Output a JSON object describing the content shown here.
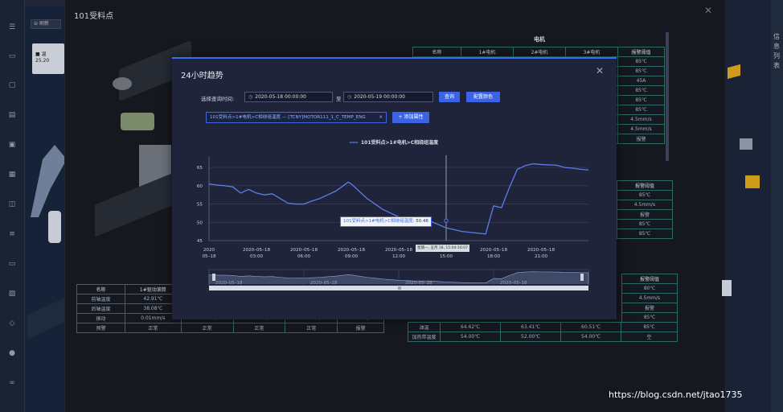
{
  "window": {
    "background_title": "101受料点"
  },
  "modal": {
    "title": "24小时趋势",
    "time_label": "选择查询时间:",
    "start_time": "2020-05-18 00:00:00",
    "separator": "至",
    "end_time": "2020-05-19 00:00:00",
    "query_button": "查询",
    "color_button": "配置颜色",
    "tag_text": "101受料点>1#电机>C相绕组温度 — [TCNY]MOTOR111_1_C_TEMP_ENG",
    "add_attr_button": "+ 添加属性"
  },
  "tooltip": {
    "series": "101受料点>1#电机>C相绕组温度:",
    "value": "50.46"
  },
  "axis_pointer_label": "星期一, 五月 18, 15:04-16:07",
  "chart_data": {
    "type": "line",
    "series": [
      {
        "name": "101受料点>1#电机>C相绕组温度",
        "color": "#5b7de8",
        "points": [
          [
            0.0,
            60.5
          ],
          [
            0.5,
            60.2
          ],
          [
            1.0,
            60.0
          ],
          [
            1.5,
            59.7
          ],
          [
            2.0,
            58.0
          ],
          [
            2.5,
            59.0
          ],
          [
            3.0,
            58.0
          ],
          [
            3.5,
            57.5
          ],
          [
            4.0,
            57.8
          ],
          [
            4.5,
            56.5
          ],
          [
            5.0,
            55.2
          ],
          [
            5.5,
            55.0
          ],
          [
            6.0,
            55.0
          ],
          [
            6.5,
            55.8
          ],
          [
            7.0,
            56.5
          ],
          [
            7.5,
            57.5
          ],
          [
            8.0,
            58.5
          ],
          [
            8.5,
            60.0
          ],
          [
            8.8,
            61.0
          ],
          [
            9.0,
            60.5
          ],
          [
            9.5,
            58.5
          ],
          [
            10.0,
            56.5
          ],
          [
            10.5,
            55.0
          ],
          [
            11.0,
            53.5
          ],
          [
            11.5,
            52.5
          ],
          [
            12.0,
            51.5
          ],
          [
            12.5,
            51.0
          ],
          [
            13.0,
            50.2
          ],
          [
            14.0,
            50.3
          ],
          [
            15.0,
            48.5
          ],
          [
            16.0,
            47.5
          ],
          [
            17.5,
            46.8
          ],
          [
            18.0,
            54.5
          ],
          [
            18.5,
            54.0
          ],
          [
            19.0,
            59.5
          ],
          [
            19.5,
            64.5
          ],
          [
            20.0,
            65.5
          ],
          [
            20.5,
            66.0
          ],
          [
            21.0,
            65.8
          ],
          [
            21.5,
            65.7
          ],
          [
            22.0,
            65.6
          ],
          [
            22.5,
            65.0
          ],
          [
            23.0,
            64.8
          ],
          [
            23.5,
            64.5
          ],
          [
            24.0,
            64.3
          ]
        ]
      }
    ],
    "x_axis": {
      "min_hours": 0,
      "max_hours": 24,
      "ticks": [
        {
          "hours": 0,
          "label": "2020\n05–18"
        },
        {
          "hours": 3,
          "label": "2020–05–18\n03:00"
        },
        {
          "hours": 6,
          "label": "2020–05–18\n06:00"
        },
        {
          "hours": 9,
          "label": "2020–05–18\n09:00"
        },
        {
          "hours": 12,
          "label": "2020–05–18\n12:00"
        },
        {
          "hours": 15,
          "label": "2020–05–18\n15:00"
        },
        {
          "hours": 18,
          "label": "2020–05–18\n18:00"
        },
        {
          "hours": 21,
          "label": "2020–05–18\n21:00"
        }
      ]
    },
    "y_axis": {
      "min": 45,
      "max": 67,
      "ticks": [
        45,
        50,
        55,
        60,
        65
      ]
    },
    "crosshair_hours": 15.0,
    "highlight_point": [
      15.0,
      50.46
    ],
    "slider_labels": [
      "2020–05–18",
      "2020–05–18",
      "2020–05–18",
      "2020–05–18"
    ]
  },
  "bg_right_table": {
    "title": "电机",
    "headers": [
      "名称",
      "1#电机",
      "2#电机",
      "3#电机",
      "报警阈值"
    ],
    "thresholds": [
      "85℃",
      "85℃",
      "45A",
      "85℃",
      "85℃",
      "85℃",
      "4.5mm/s",
      "4.5mm/s",
      "报警"
    ]
  },
  "bg_right_table2": {
    "header": "报警阈值",
    "values": [
      "85℃",
      "4.5mm/s",
      "报警",
      "85℃",
      "85℃"
    ]
  },
  "bg_right_table3": {
    "header": "报警阈值",
    "values": [
      "80℃",
      "4.5mm/s",
      "报警",
      "85℃"
    ],
    "rows": [
      [
        "油温",
        "64.62℃",
        "63.41℃",
        "60.51℃",
        "85℃"
      ],
      [
        "加热带温度",
        "54.00℃",
        "52.00℃",
        "54.00℃",
        "空"
      ]
    ]
  },
  "bg_left_table": {
    "headers": [
      "名称",
      "1#驱动滚筒"
    ],
    "rows": [
      [
        "前轴温度",
        "42.91℃",
        "",
        "",
        "",
        ""
      ],
      [
        "后轴温度",
        "38.08℃",
        "",
        "",
        "",
        ""
      ],
      [
        "振动",
        "0.01mm/s",
        "0.17mm/s",
        "0.14mm/s",
        "0.18mm/s",
        "4.5mm/s"
      ],
      [
        "预警",
        "正常",
        "正常",
        "正常",
        "正常",
        "报警"
      ]
    ]
  },
  "bg_left_chip": {
    "l1": "温",
    "l2": "25.20"
  },
  "bg_button": "刷新",
  "far_right_text": [
    "信",
    "息",
    "列",
    "表"
  ],
  "watermark": "https://blog.csdn.net/jtao1735"
}
